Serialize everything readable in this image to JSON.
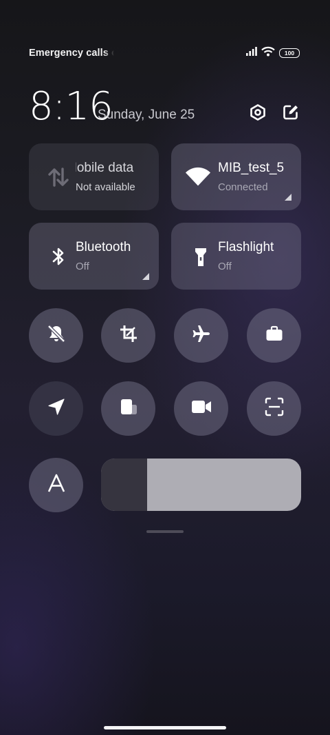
{
  "status_bar": {
    "carrier_text": "Emergency calls o",
    "battery": "100",
    "icons": [
      "signal-icon",
      "wifi-icon",
      "battery-icon"
    ]
  },
  "header": {
    "time": "8:16",
    "date": "Sunday, June 25",
    "icons": [
      "settings-icon",
      "edit-icon"
    ]
  },
  "tiles": [
    {
      "name": "mobile-data",
      "title": "Mobile data",
      "subtitle": "Not available",
      "icon": "mobile-data-icon",
      "active": false
    },
    {
      "name": "wifi",
      "title": "MIB_test_5",
      "subtitle": "Connected",
      "icon": "wifi-icon",
      "active": true
    },
    {
      "name": "bluetooth",
      "title": "Bluetooth",
      "subtitle": "Off",
      "icon": "bluetooth-icon",
      "active": false
    },
    {
      "name": "flashlight",
      "title": "Flashlight",
      "subtitle": "Off",
      "icon": "flashlight-icon",
      "active": false
    }
  ],
  "toggles_row1": [
    "silent-icon",
    "screenshot-crop-icon",
    "airplane-icon",
    "work-briefcase-icon"
  ],
  "toggles_row2": [
    "location-icon",
    "floating-window-icon",
    "video-camera-icon",
    "scan-icon"
  ],
  "auto_brightness": {
    "label": "A",
    "icon": "auto-brightness-icon"
  },
  "brightness_level": 0.23,
  "colors": {
    "tile_active": "#5c5a6e",
    "brightness_fill": "#aeadb4",
    "brightness_track": "#36343f"
  }
}
